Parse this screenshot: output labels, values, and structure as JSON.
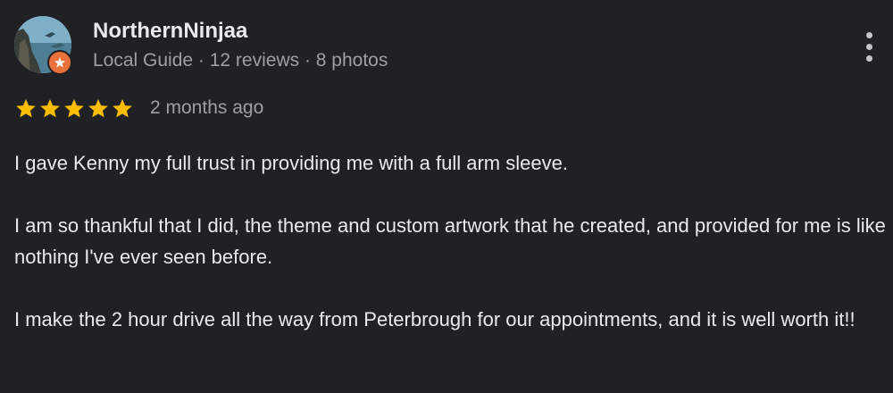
{
  "reviewer": {
    "name": "NorthernNinjaa",
    "meta": "Local Guide · 12 reviews · 8 photos",
    "avatar_icon": "avatar-photo",
    "badge_icon": "local-guide-badge-icon",
    "badge_color": "#e8703a"
  },
  "review": {
    "rating": 5,
    "rating_max": 5,
    "star_color": "#fbbc04",
    "time": "2 months ago",
    "paragraphs": [
      "I gave Kenny my full trust in providing me with a full arm sleeve.",
      "I am so thankful that I did, the theme and custom artwork that he created, and provided for me is like nothing I've ever seen before.",
      "I make the 2 hour drive all the way from Peterbrough for our appointments, and it is well worth it!!"
    ]
  },
  "menu": {
    "icon": "more-vert-icon"
  },
  "theme": {
    "background": "#202124",
    "text": "#e8eaed",
    "secondary_text": "#9aa0a6"
  }
}
